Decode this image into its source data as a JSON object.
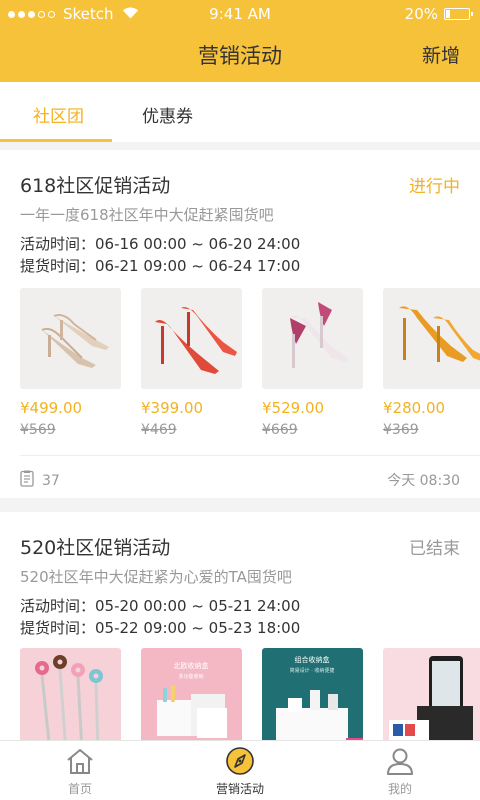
{
  "status_bar": {
    "carrier": "Sketch",
    "time": "9:41 AM",
    "battery": "20%"
  },
  "nav": {
    "title": "营销活动",
    "action": "新增"
  },
  "tabs": [
    {
      "label": "社区团",
      "active": true
    },
    {
      "label": "优惠券",
      "active": false
    }
  ],
  "activities": [
    {
      "title": "618社区促销活动",
      "status": "进行中",
      "subtitle": "一年一度618社区年中大促赶紧囤货吧",
      "activity_time": "活动时间：06-16 00:00 ~ 06-20 24:00",
      "pickup_time": "提货时间：06-21 09:00 ~ 06-24 17:00",
      "products": [
        {
          "price": "¥499.00",
          "original": "¥569",
          "image": "nude-heels"
        },
        {
          "price": "¥399.00",
          "original": "¥469",
          "image": "red-heels"
        },
        {
          "price": "¥529.00",
          "original": "¥669",
          "image": "pink-heels"
        },
        {
          "price": "¥280.00",
          "original": "¥369",
          "image": "orange-heels"
        }
      ],
      "count": "37",
      "updated": "今天 08:30"
    },
    {
      "title": "520社区促销活动",
      "status": "已结束",
      "subtitle": "520社区年中大促赶紧为心爱的TA囤货吧",
      "activity_time": "活动时间：05-20 00:00 ~ 05-21 24:00",
      "pickup_time": "提货时间：05-22 09:00 ~ 05-23 18:00",
      "products": [
        {
          "image": "donut-cutlery"
        },
        {
          "image": "pink-storage-box",
          "text": "北欧收纳盒",
          "text2": "多功能收纳"
        },
        {
          "image": "teal-storage-box",
          "text": "组合收纳盒",
          "text2": "简易设计 · 收纳便捷"
        },
        {
          "image": "phone-stand"
        }
      ]
    }
  ],
  "bottom_nav": [
    {
      "label": "首页",
      "icon": "home-icon",
      "active": false
    },
    {
      "label": "营销活动",
      "icon": "compass-icon",
      "active": true
    },
    {
      "label": "我的",
      "icon": "user-icon",
      "active": false
    }
  ],
  "colors": {
    "brand": "#f6c23a",
    "accent_text": "#f3b21f",
    "muted": "#999999"
  }
}
